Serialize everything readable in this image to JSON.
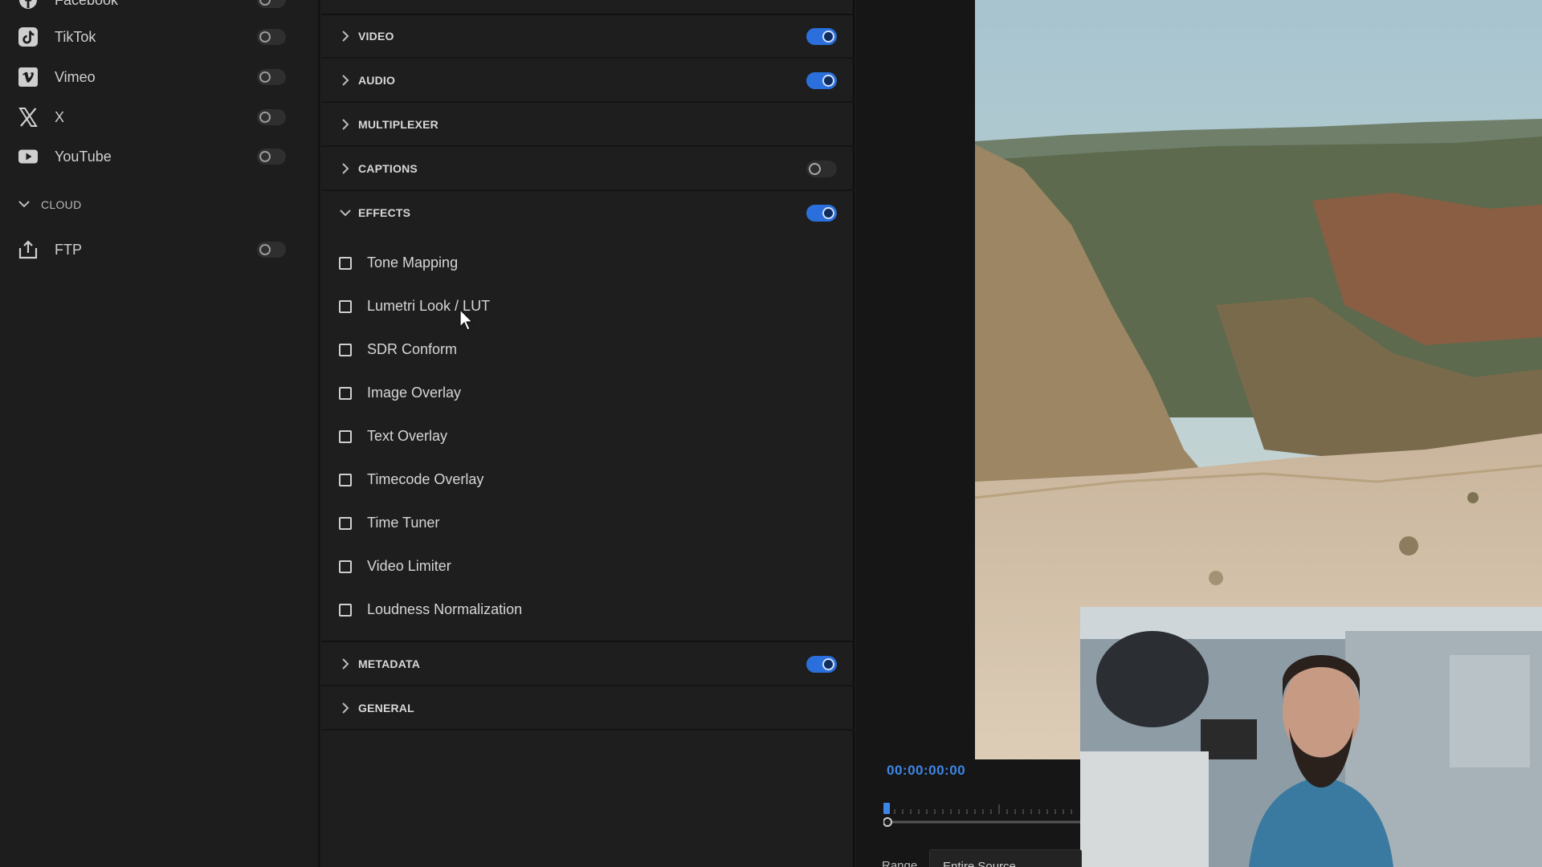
{
  "destinations": {
    "social": [
      {
        "name": "Facebook",
        "icon": "facebook-icon",
        "enabled": false
      },
      {
        "name": "TikTok",
        "icon": "tiktok-icon",
        "enabled": false
      },
      {
        "name": "Vimeo",
        "icon": "vimeo-icon",
        "enabled": false
      },
      {
        "name": "X",
        "icon": "x-icon",
        "enabled": false
      },
      {
        "name": "YouTube",
        "icon": "youtube-icon",
        "enabled": false
      }
    ],
    "cloud_group": {
      "label": "CLOUD",
      "expanded": true
    },
    "cloud": [
      {
        "name": "FTP",
        "icon": "upload-icon",
        "enabled": false
      }
    ]
  },
  "settings": {
    "sections_top": [
      {
        "key": "video",
        "label": "VIDEO",
        "enabled": true
      },
      {
        "key": "audio",
        "label": "AUDIO",
        "enabled": true
      },
      {
        "key": "multiplexer",
        "label": "MULTIPLEXER",
        "enabled": null
      },
      {
        "key": "captions",
        "label": "CAPTIONS",
        "enabled": false
      },
      {
        "key": "effects",
        "label": "EFFECTS",
        "enabled": true,
        "expanded": true
      }
    ],
    "effects": [
      {
        "label": "Tone Mapping",
        "checked": false
      },
      {
        "label": "Lumetri Look / LUT",
        "checked": false
      },
      {
        "label": "SDR Conform",
        "checked": false
      },
      {
        "label": "Image Overlay",
        "checked": false
      },
      {
        "label": "Text Overlay",
        "checked": false
      },
      {
        "label": "Timecode Overlay",
        "checked": false
      },
      {
        "label": "Time Tuner",
        "checked": false
      },
      {
        "label": "Video Limiter",
        "checked": false
      },
      {
        "label": "Loudness Normalization",
        "checked": false
      }
    ],
    "sections_bottom": [
      {
        "key": "metadata",
        "label": "METADATA",
        "enabled": true
      },
      {
        "key": "general",
        "label": "GENERAL",
        "enabled": null
      }
    ]
  },
  "preview": {
    "timecode": "00:00:00:00",
    "range_label": "Range",
    "range_value": "Entire Source"
  },
  "colors": {
    "accent": "#2a6fdb",
    "timecode": "#3d86e8",
    "panel": "#1e1e1e"
  }
}
